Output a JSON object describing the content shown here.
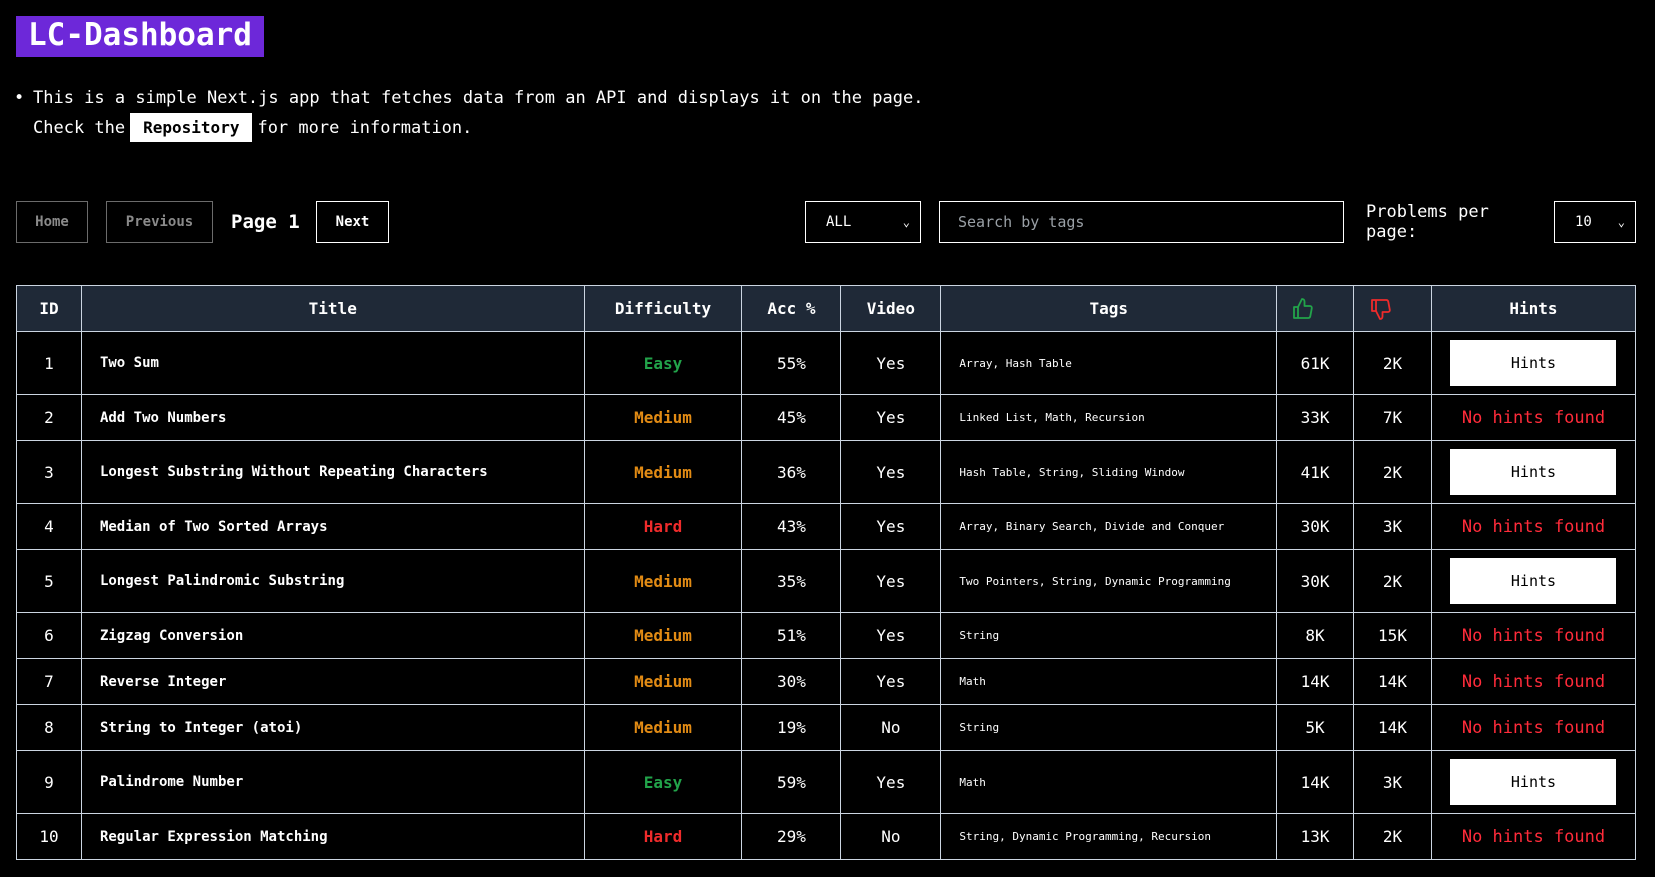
{
  "app": {
    "title": "LC-Dashboard"
  },
  "description": {
    "line1": "This is a simple Next.js app that fetches data from an API and displays it on the page.",
    "line2_before": "Check the",
    "repo_label": "Repository",
    "line2_after": "for more information."
  },
  "controls": {
    "home_label": "Home",
    "previous_label": "Previous",
    "page_label": "Page 1",
    "next_label": "Next",
    "difficulty_selected": "ALL",
    "search_placeholder": "Search by tags",
    "ppp_label": "Problems per page:",
    "ppp_selected": "10"
  },
  "colors": {
    "accent": "#6d28d9",
    "easy": "#22a34a",
    "medium": "#e28b14",
    "hard": "#ef2b2b",
    "thumbs_up": "#22a34a",
    "thumbs_down": "#ef2b2b",
    "no_hints": "#ff2b3a"
  },
  "table": {
    "headers": {
      "id": "ID",
      "title": "Title",
      "difficulty": "Difficulty",
      "acc": "Acc %",
      "video": "Video",
      "tags": "Tags",
      "likes_icon": "thumbs-up-icon",
      "dislikes_icon": "thumbs-down-icon",
      "hints": "Hints"
    },
    "hints_button_label": "Hints",
    "no_hints_label": "No hints found",
    "rows": [
      {
        "id": "1",
        "title": "Two Sum",
        "difficulty": "Easy",
        "acc": "55%",
        "video": "Yes",
        "tags": "Array, Hash Table",
        "likes": "61K",
        "dislikes": "2K",
        "has_hints": true
      },
      {
        "id": "2",
        "title": "Add Two Numbers",
        "difficulty": "Medium",
        "acc": "45%",
        "video": "Yes",
        "tags": "Linked List, Math, Recursion",
        "likes": "33K",
        "dislikes": "7K",
        "has_hints": false
      },
      {
        "id": "3",
        "title": "Longest Substring Without Repeating Characters",
        "difficulty": "Medium",
        "acc": "36%",
        "video": "Yes",
        "tags": "Hash Table, String, Sliding Window",
        "likes": "41K",
        "dislikes": "2K",
        "has_hints": true
      },
      {
        "id": "4",
        "title": "Median of Two Sorted Arrays",
        "difficulty": "Hard",
        "acc": "43%",
        "video": "Yes",
        "tags": "Array, Binary Search, Divide and Conquer",
        "likes": "30K",
        "dislikes": "3K",
        "has_hints": false
      },
      {
        "id": "5",
        "title": "Longest Palindromic Substring",
        "difficulty": "Medium",
        "acc": "35%",
        "video": "Yes",
        "tags": "Two Pointers, String, Dynamic Programming",
        "likes": "30K",
        "dislikes": "2K",
        "has_hints": true
      },
      {
        "id": "6",
        "title": "Zigzag Conversion",
        "difficulty": "Medium",
        "acc": "51%",
        "video": "Yes",
        "tags": "String",
        "likes": "8K",
        "dislikes": "15K",
        "has_hints": false
      },
      {
        "id": "7",
        "title": "Reverse Integer",
        "difficulty": "Medium",
        "acc": "30%",
        "video": "Yes",
        "tags": "Math",
        "likes": "14K",
        "dislikes": "14K",
        "has_hints": false
      },
      {
        "id": "8",
        "title": "String to Integer (atoi)",
        "difficulty": "Medium",
        "acc": "19%",
        "video": "No",
        "tags": "String",
        "likes": "5K",
        "dislikes": "14K",
        "has_hints": false
      },
      {
        "id": "9",
        "title": "Palindrome Number",
        "difficulty": "Easy",
        "acc": "59%",
        "video": "Yes",
        "tags": "Math",
        "likes": "14K",
        "dislikes": "3K",
        "has_hints": true
      },
      {
        "id": "10",
        "title": "Regular Expression Matching",
        "difficulty": "Hard",
        "acc": "29%",
        "video": "No",
        "tags": "String, Dynamic Programming, Recursion",
        "likes": "13K",
        "dislikes": "2K",
        "has_hints": false
      }
    ]
  }
}
